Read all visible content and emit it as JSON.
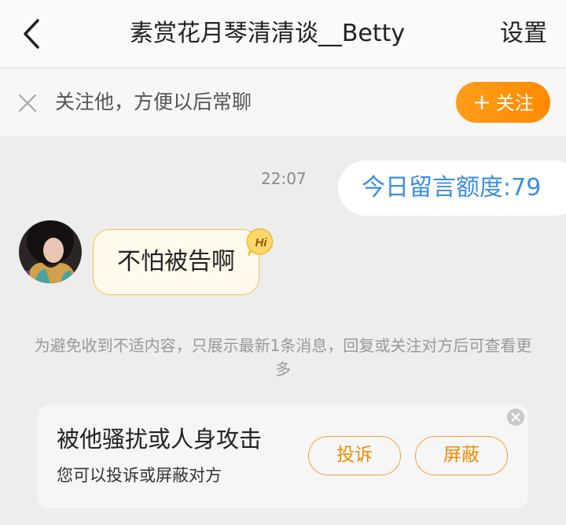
{
  "header": {
    "back_icon": "chevron-left-icon",
    "title": "素赏花月琴清清谈__Betty",
    "settings_label": "设置"
  },
  "follow_bar": {
    "close_icon": "close-icon",
    "text": "关注他，方便以后常聊",
    "button_plus": "+",
    "button_label": "关注",
    "button_color": "#ff8a00"
  },
  "chat": {
    "time": "22:07",
    "outgoing_message": "今日留言额度:79",
    "incoming_message": "不怕被告啊",
    "hi_badge": "Hi",
    "avatar_icon": "user-avatar"
  },
  "notice": "为避免收到不适内容，只展示最新1条消息，回复或关注对方后可查看更多",
  "report_card": {
    "title": "被他骚扰或人身攻击",
    "subtitle": "您可以投诉或屏蔽对方",
    "report_label": "投诉",
    "block_label": "屏蔽",
    "close_icon": "close-circle-icon",
    "accent_color": "#f08c00"
  }
}
